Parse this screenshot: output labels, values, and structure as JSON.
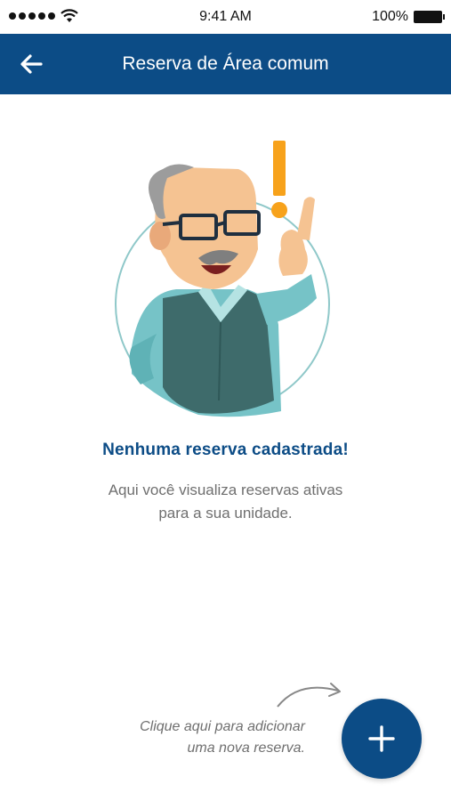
{
  "status_bar": {
    "time": "9:41 AM",
    "battery": "100%",
    "signal_icon": "signal-dots-icon",
    "wifi_icon": "wifi-icon",
    "battery_icon": "battery-icon"
  },
  "header": {
    "title": "Reserva de Área comum",
    "back_icon": "back-arrow-icon",
    "background": "#0c4c86"
  },
  "empty_state": {
    "illustration": "character-with-exclamation",
    "title": "Nenhuma reserva cadastrada!",
    "description_line1": "Aqui você visualiza reservas ativas",
    "description_line2": "para a sua unidade.",
    "title_color": "#0c4c86"
  },
  "hint": {
    "line1": "Clique aqui para adicionar",
    "line2": "uma nova reserva."
  },
  "fab": {
    "icon": "plus-icon",
    "color": "#0c4c86"
  }
}
